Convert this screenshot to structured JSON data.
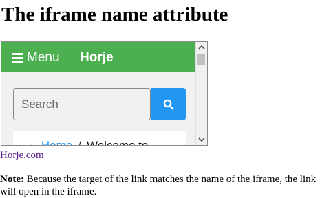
{
  "page": {
    "title": "The iframe name attribute"
  },
  "iframe": {
    "menu_label": "Menu",
    "brand": "Horje",
    "search_placeholder": "Search",
    "breadcrumb": {
      "home": "Home",
      "separator": "/",
      "current": "Welcome to"
    },
    "colors": {
      "navbar": "#4caf50",
      "search_button": "#2196f3",
      "background": "#f1f1f1"
    },
    "icons": [
      "hamburger-icon",
      "search-icon",
      "code-icon",
      "scroll-up-icon",
      "scroll-down-icon"
    ]
  },
  "link": {
    "text": "Horje.com"
  },
  "note": {
    "label": "Note:",
    "text": "Because the target of the link matches the name of the iframe, the link will open in the iframe."
  }
}
